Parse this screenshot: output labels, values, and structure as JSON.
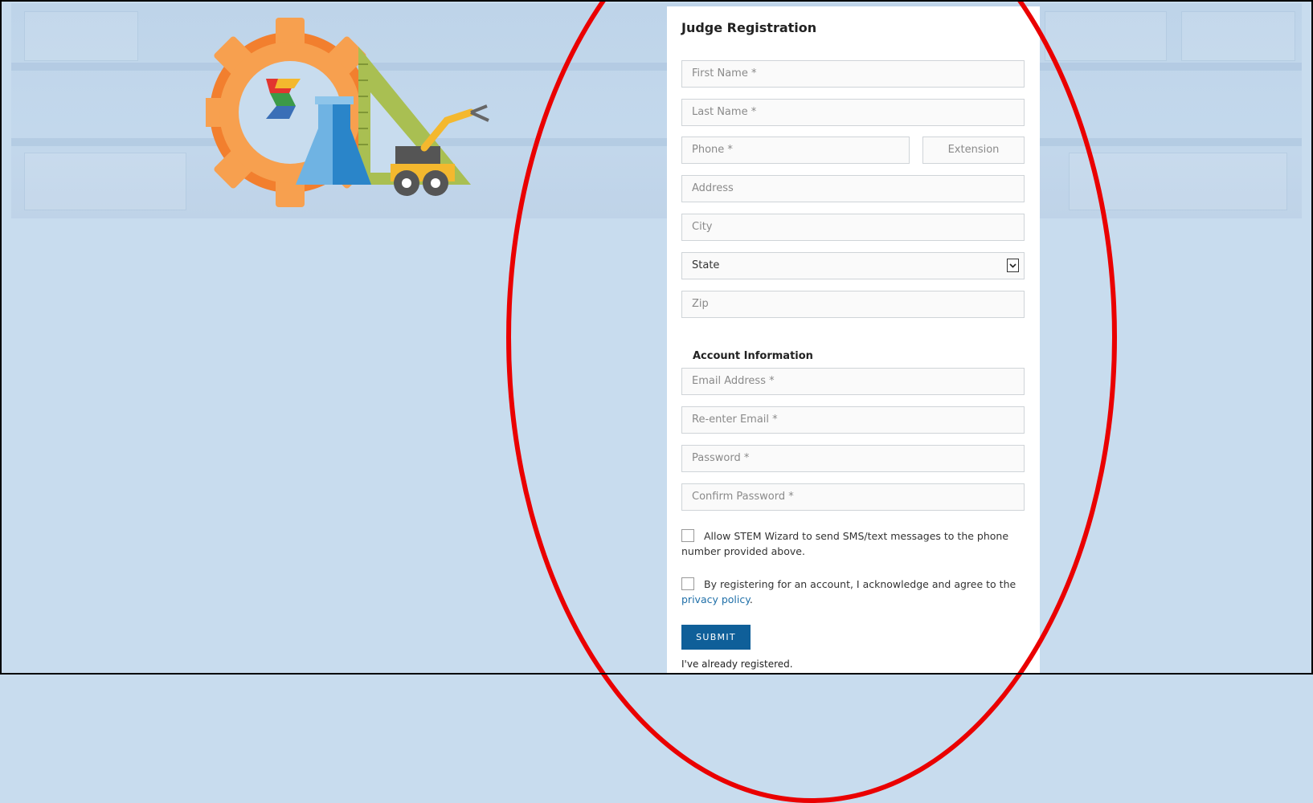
{
  "form": {
    "title": "Judge Registration",
    "fields": {
      "first_name": "First Name *",
      "last_name": "Last Name *",
      "phone": "Phone *",
      "extension": "Extension",
      "address": "Address",
      "city": "City",
      "state": "State",
      "zip": "Zip"
    },
    "account_section": "Account Information",
    "account_fields": {
      "email": "Email Address *",
      "reenter_email": "Re-enter Email *",
      "password": "Password *",
      "confirm_password": "Confirm Password *"
    },
    "sms_consent": "Allow STEM Wizard to send SMS/text messages to the phone number provided above.",
    "privacy_prefix": "By registering for an account, I acknowledge and agree to the",
    "privacy_link": "privacy policy",
    "privacy_suffix": ".",
    "submit_label": "SUBMIT",
    "already_registered": "I've already registered."
  },
  "colors": {
    "background": "#c8dcee",
    "submit": "#0f5f99",
    "link": "#1f6fa8",
    "annotation": "#ea0000"
  },
  "icons": [
    "stem-wizard-logo",
    "chevron-down-icon"
  ]
}
